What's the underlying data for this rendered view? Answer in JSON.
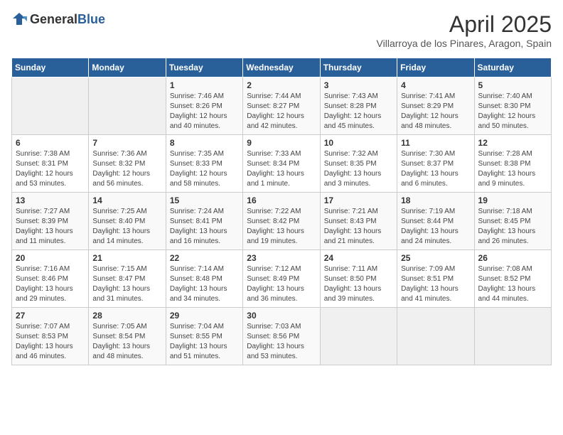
{
  "header": {
    "logo_general": "General",
    "logo_blue": "Blue",
    "title": "April 2025",
    "location": "Villarroya de los Pinares, Aragon, Spain"
  },
  "days_of_week": [
    "Sunday",
    "Monday",
    "Tuesday",
    "Wednesday",
    "Thursday",
    "Friday",
    "Saturday"
  ],
  "weeks": [
    [
      {
        "day": "",
        "info": ""
      },
      {
        "day": "",
        "info": ""
      },
      {
        "day": "1",
        "info": "Sunrise: 7:46 AM\nSunset: 8:26 PM\nDaylight: 12 hours\nand 40 minutes."
      },
      {
        "day": "2",
        "info": "Sunrise: 7:44 AM\nSunset: 8:27 PM\nDaylight: 12 hours\nand 42 minutes."
      },
      {
        "day": "3",
        "info": "Sunrise: 7:43 AM\nSunset: 8:28 PM\nDaylight: 12 hours\nand 45 minutes."
      },
      {
        "day": "4",
        "info": "Sunrise: 7:41 AM\nSunset: 8:29 PM\nDaylight: 12 hours\nand 48 minutes."
      },
      {
        "day": "5",
        "info": "Sunrise: 7:40 AM\nSunset: 8:30 PM\nDaylight: 12 hours\nand 50 minutes."
      }
    ],
    [
      {
        "day": "6",
        "info": "Sunrise: 7:38 AM\nSunset: 8:31 PM\nDaylight: 12 hours\nand 53 minutes."
      },
      {
        "day": "7",
        "info": "Sunrise: 7:36 AM\nSunset: 8:32 PM\nDaylight: 12 hours\nand 56 minutes."
      },
      {
        "day": "8",
        "info": "Sunrise: 7:35 AM\nSunset: 8:33 PM\nDaylight: 12 hours\nand 58 minutes."
      },
      {
        "day": "9",
        "info": "Sunrise: 7:33 AM\nSunset: 8:34 PM\nDaylight: 13 hours\nand 1 minute."
      },
      {
        "day": "10",
        "info": "Sunrise: 7:32 AM\nSunset: 8:35 PM\nDaylight: 13 hours\nand 3 minutes."
      },
      {
        "day": "11",
        "info": "Sunrise: 7:30 AM\nSunset: 8:37 PM\nDaylight: 13 hours\nand 6 minutes."
      },
      {
        "day": "12",
        "info": "Sunrise: 7:28 AM\nSunset: 8:38 PM\nDaylight: 13 hours\nand 9 minutes."
      }
    ],
    [
      {
        "day": "13",
        "info": "Sunrise: 7:27 AM\nSunset: 8:39 PM\nDaylight: 13 hours\nand 11 minutes."
      },
      {
        "day": "14",
        "info": "Sunrise: 7:25 AM\nSunset: 8:40 PM\nDaylight: 13 hours\nand 14 minutes."
      },
      {
        "day": "15",
        "info": "Sunrise: 7:24 AM\nSunset: 8:41 PM\nDaylight: 13 hours\nand 16 minutes."
      },
      {
        "day": "16",
        "info": "Sunrise: 7:22 AM\nSunset: 8:42 PM\nDaylight: 13 hours\nand 19 minutes."
      },
      {
        "day": "17",
        "info": "Sunrise: 7:21 AM\nSunset: 8:43 PM\nDaylight: 13 hours\nand 21 minutes."
      },
      {
        "day": "18",
        "info": "Sunrise: 7:19 AM\nSunset: 8:44 PM\nDaylight: 13 hours\nand 24 minutes."
      },
      {
        "day": "19",
        "info": "Sunrise: 7:18 AM\nSunset: 8:45 PM\nDaylight: 13 hours\nand 26 minutes."
      }
    ],
    [
      {
        "day": "20",
        "info": "Sunrise: 7:16 AM\nSunset: 8:46 PM\nDaylight: 13 hours\nand 29 minutes."
      },
      {
        "day": "21",
        "info": "Sunrise: 7:15 AM\nSunset: 8:47 PM\nDaylight: 13 hours\nand 31 minutes."
      },
      {
        "day": "22",
        "info": "Sunrise: 7:14 AM\nSunset: 8:48 PM\nDaylight: 13 hours\nand 34 minutes."
      },
      {
        "day": "23",
        "info": "Sunrise: 7:12 AM\nSunset: 8:49 PM\nDaylight: 13 hours\nand 36 minutes."
      },
      {
        "day": "24",
        "info": "Sunrise: 7:11 AM\nSunset: 8:50 PM\nDaylight: 13 hours\nand 39 minutes."
      },
      {
        "day": "25",
        "info": "Sunrise: 7:09 AM\nSunset: 8:51 PM\nDaylight: 13 hours\nand 41 minutes."
      },
      {
        "day": "26",
        "info": "Sunrise: 7:08 AM\nSunset: 8:52 PM\nDaylight: 13 hours\nand 44 minutes."
      }
    ],
    [
      {
        "day": "27",
        "info": "Sunrise: 7:07 AM\nSunset: 8:53 PM\nDaylight: 13 hours\nand 46 minutes."
      },
      {
        "day": "28",
        "info": "Sunrise: 7:05 AM\nSunset: 8:54 PM\nDaylight: 13 hours\nand 48 minutes."
      },
      {
        "day": "29",
        "info": "Sunrise: 7:04 AM\nSunset: 8:55 PM\nDaylight: 13 hours\nand 51 minutes."
      },
      {
        "day": "30",
        "info": "Sunrise: 7:03 AM\nSunset: 8:56 PM\nDaylight: 13 hours\nand 53 minutes."
      },
      {
        "day": "",
        "info": ""
      },
      {
        "day": "",
        "info": ""
      },
      {
        "day": "",
        "info": ""
      }
    ]
  ]
}
